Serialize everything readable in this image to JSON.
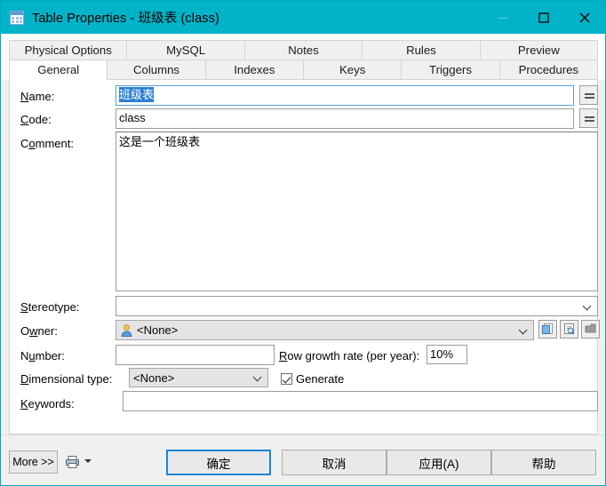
{
  "window": {
    "title": "Table Properties - 班级表 (class)",
    "icon": "table-icon",
    "titlebar_color": "#00b3c8",
    "controls": {
      "minimize": "minimize-icon",
      "maximize": "maximize-icon",
      "close": "close-icon"
    }
  },
  "tabs": {
    "row1": [
      {
        "label": "Physical Options",
        "active": false
      },
      {
        "label": "MySQL",
        "active": false
      },
      {
        "label": "Notes",
        "active": false
      },
      {
        "label": "Rules",
        "active": false
      },
      {
        "label": "Preview",
        "active": false
      }
    ],
    "row2": [
      {
        "label": "General",
        "active": true
      },
      {
        "label": "Columns",
        "active": false
      },
      {
        "label": "Indexes",
        "active": false
      },
      {
        "label": "Keys",
        "active": false
      },
      {
        "label": "Triggers",
        "active": false
      },
      {
        "label": "Procedures",
        "active": false
      }
    ]
  },
  "form": {
    "name": {
      "label": "Name:",
      "accel": "N",
      "value": "班级表",
      "selected": true,
      "focused": true
    },
    "code": {
      "label": "Code:",
      "accel": "C",
      "value": "class"
    },
    "comment": {
      "label": "Comment:",
      "accel": "o",
      "value": "这是一个班级表"
    },
    "stereotype": {
      "label": "Stereotype:",
      "accel": "S",
      "value": "",
      "placeholder": ""
    },
    "owner": {
      "label": "Owner:",
      "accel": "w",
      "value": "<None>",
      "icon": "user-icon",
      "buttons": [
        "create-owner-button",
        "properties-owner-button",
        "delete-owner-button"
      ]
    },
    "number": {
      "label": "Number:",
      "accel": "u",
      "value": ""
    },
    "row_growth_rate": {
      "label": "Row growth rate (per year):",
      "accel": "R",
      "value": "10%"
    },
    "dimensional_type": {
      "label": "Dimensional type:",
      "accel": "D",
      "value": "<None>",
      "disabled": true
    },
    "generate": {
      "label": "Generate",
      "accel": "G",
      "checked": true
    },
    "keywords": {
      "label": "Keywords:",
      "accel": "K",
      "value": ""
    },
    "equals_button_label": "="
  },
  "footer": {
    "more": "More >>",
    "print_icon": "printer-icon",
    "print_dropdown": "chevron-down-icon",
    "ok": "确定",
    "cancel": "取消",
    "apply": "应用(A)",
    "apply_accel": "A",
    "help": "帮助"
  }
}
